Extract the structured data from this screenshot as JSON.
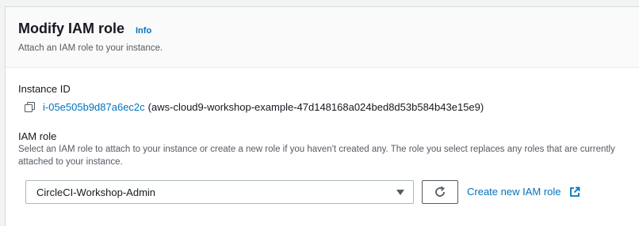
{
  "header": {
    "title": "Modify IAM role",
    "info_link": "Info",
    "subtitle": "Attach an IAM role to your instance."
  },
  "instance": {
    "label": "Instance ID",
    "id": "i-05e505b9d87a6ec2c",
    "name": "(aws-cloud9-workshop-example-47d148168a024bed8d53b584b43e15e9)"
  },
  "iam_role": {
    "label": "IAM role",
    "description": "Select an IAM role to attach to your instance or create a new role if you haven't created any. The role you select replaces any roles that are currently attached to your instance.",
    "selected": "CircleCI-Workshop-Admin",
    "create_link": "Create new IAM role"
  },
  "icons": {
    "copy": "copy-icon",
    "dropdown": "caret-down-icon",
    "refresh": "refresh-icon",
    "external": "external-link-icon"
  },
  "colors": {
    "link": "#0073bb",
    "text": "#16191f",
    "muted": "#545b64",
    "header_bg": "#fafafa"
  }
}
